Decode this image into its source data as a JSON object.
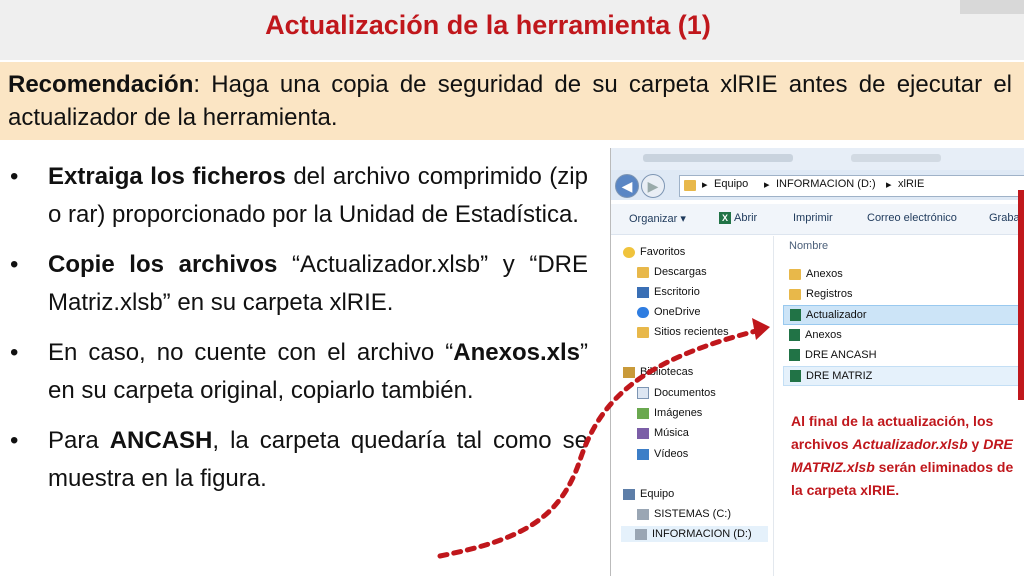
{
  "slide": {
    "title": "Actualización de la herramienta (1)",
    "recommendation": {
      "label": "Recomendación",
      "text": ": Haga una copia de seguridad de su carpeta xlRIE antes de ejecutar el actualizador de la herramienta."
    },
    "bullets": [
      {
        "parts": [
          {
            "t": "Extraiga los ficheros",
            "b": true
          },
          {
            "t": " del archivo comprimido (zip o rar) proporcionado por la Unidad de Estadística.",
            "b": false
          }
        ]
      },
      {
        "parts": [
          {
            "t": "Copie los archivos",
            "b": true
          },
          {
            "t": " “Actualizador.xlsb” y “DRE Matriz.xlsb” en su carpeta xlRIE.",
            "b": false
          }
        ]
      },
      {
        "parts": [
          {
            "t": "En caso, no cuente con el archivo “",
            "b": false
          },
          {
            "t": "Anexos.xls",
            "b": true
          },
          {
            "t": "” en su carpeta original, copiarlo también.",
            "b": false
          }
        ]
      },
      {
        "parts": [
          {
            "t": "Para ",
            "b": false
          },
          {
            "t": "ANCASH",
            "b": true
          },
          {
            "t": ", la carpeta quedaría tal como se muestra en la figura.",
            "b": false
          }
        ]
      }
    ],
    "bullet_glyph": "•"
  },
  "explorer": {
    "breadcrumb": [
      "Equipo",
      "INFORMACION (D:)",
      "xlRIE"
    ],
    "crumb_sep": "▸",
    "toolbar": {
      "organize": "Organizar ▾",
      "open": "Abrir",
      "print": "Imprimir",
      "email": "Correo electrónico",
      "save": "Grabar"
    },
    "nav": {
      "favorites": "Favoritos",
      "downloads": "Descargas",
      "desktop": "Escritorio",
      "onedrive": "OneDrive",
      "recent": "Sitios recientes",
      "libraries": "Bibliotecas",
      "documents": "Documentos",
      "images": "Imágenes",
      "music": "Música",
      "videos": "Vídeos",
      "computer": "Equipo",
      "drive_c": "SISTEMAS (C:)",
      "drive_d": "INFORMACION (D:)"
    },
    "column_header": "Nombre",
    "files": [
      "Anexos",
      "Registros",
      "Actualizador",
      "Anexos",
      "DRE ANCASH",
      "DRE MATRIZ"
    ]
  },
  "note": {
    "line1": "Al final de la actualización, los archivos ",
    "file1": "Actualizador.xlsb",
    "mid": " y ",
    "file2": "DRE MATRIZ.xlsb",
    "line2": " serán eliminados de la carpeta xlRIE."
  },
  "colors": {
    "title": "#c0171c",
    "recommend_bg": "#fbe5c4",
    "accent_red": "#c0171c"
  }
}
